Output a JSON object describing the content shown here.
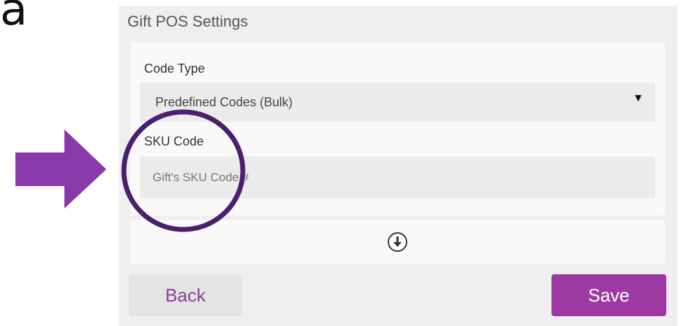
{
  "stray_text": "a",
  "panel": {
    "title": "Gift POS Settings",
    "code_type": {
      "label": "Code Type",
      "selected": "Predefined Codes (Bulk)",
      "caret": "▼"
    },
    "sku_code": {
      "label": "SKU Code",
      "value": "",
      "placeholder": "Gift's SKU Code #"
    },
    "expand_icon": "circle-arrow-down-icon"
  },
  "buttons": {
    "back_label": "Back",
    "save_label": "Save"
  },
  "annotations": {
    "arrow_icon": "right-arrow-icon",
    "circle_icon": "highlight-circle-icon"
  },
  "colors": {
    "accent": "#9c3aa2",
    "back_text": "#8b3f97",
    "back_bg": "#e2e5e1",
    "annotation": "#8a3aa8",
    "annotation_ring": "#4a1f6e",
    "panel_bg": "#efefef"
  }
}
